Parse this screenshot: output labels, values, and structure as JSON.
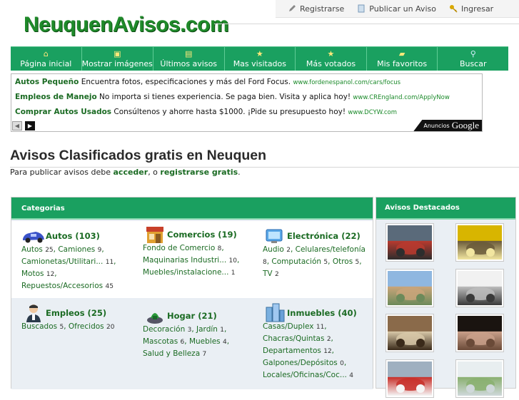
{
  "site": {
    "logo": "NeuquenAvisos.com"
  },
  "toplinks": [
    {
      "label": "Registrarse",
      "icon": "pencil-icon"
    },
    {
      "label": "Publicar un Aviso",
      "icon": "document-icon"
    },
    {
      "label": "Ingresar",
      "icon": "key-icon"
    }
  ],
  "nav": [
    {
      "label": "Página inicial",
      "icon": "home-icon"
    },
    {
      "label": "Mostrar imágenes",
      "icon": "images-icon"
    },
    {
      "label": "Últimos avisos",
      "icon": "latest-icon"
    },
    {
      "label": "Mas visitados",
      "icon": "star-icon"
    },
    {
      "label": "Más votados",
      "icon": "star-icon"
    },
    {
      "label": "Mis favoritos",
      "icon": "favorites-icon"
    },
    {
      "label": "Buscar",
      "icon": "search-icon"
    }
  ],
  "ads": [
    {
      "title": "Autos Pequeño",
      "text": " Encuentra fotos, especificaciones y más del Ford Focus.",
      "url": "www.fordenespanol.com/cars/focus"
    },
    {
      "title": "Empleos de Manejo",
      "text": " No importa si tienes experiencia. Se paga bien. Visita y aplica hoy!",
      "url": "www.CREngland.com/ApplyNow"
    },
    {
      "title": "Comprar Autos Usados",
      "text": " Consúltenos y ahorre hasta $1000. ¡Pide su presupuesto hoy!",
      "url": "www.DCYW.com"
    }
  ],
  "ad_badge": {
    "prefix": "Anuncios",
    "brand": "Google"
  },
  "heading": "Avisos Clasificados gratis en Neuquen",
  "subtitle": {
    "before": "Para publicar avisos debe ",
    "link1": "acceder",
    "mid": ", o ",
    "link2": "registrarse gratis",
    "after": "."
  },
  "categories_title": "Categorias",
  "categories": [
    {
      "name": "Autos",
      "count": "(103)",
      "icon": "car-icon",
      "subs": [
        [
          "Autos",
          "25"
        ],
        [
          "Camiones",
          "9"
        ],
        [
          "Camionetas/Utilitari...",
          "11"
        ],
        [
          "Motos",
          "12"
        ],
        [
          "Repuestos/Accesorios",
          "45"
        ]
      ]
    },
    {
      "name": "Comercios",
      "count": "(19)",
      "icon": "store-icon",
      "subs": [
        [
          "Fondo de Comercio",
          "8"
        ],
        [
          "Maquinarias Industri...",
          "10"
        ],
        [
          "Muebles/instalacione...",
          "1"
        ]
      ]
    },
    {
      "name": "Electrónica",
      "count": "(22)",
      "icon": "electronics-icon",
      "subs": [
        [
          "Audio",
          "2"
        ],
        [
          "Celulares/telefonía",
          "8"
        ],
        [
          "Computación",
          "5"
        ],
        [
          "Otros",
          "5"
        ],
        [
          "TV",
          "2"
        ]
      ]
    },
    {
      "name": "Empleos",
      "count": "(25)",
      "icon": "worker-icon",
      "subs": [
        [
          "Buscados",
          "5"
        ],
        [
          "Ofrecidos",
          "20"
        ]
      ]
    },
    {
      "name": "Hogar",
      "count": "(21)",
      "icon": "home-plant-icon",
      "subs": [
        [
          "Decoración",
          "3"
        ],
        [
          "Jardín",
          "1"
        ],
        [
          "Mascotas",
          "6"
        ],
        [
          "Muebles",
          "4"
        ],
        [
          "Salud y Belleza",
          "7"
        ]
      ]
    },
    {
      "name": "Inmuebles",
      "count": "(40)",
      "icon": "buildings-icon",
      "subs": [
        [
          "Casas/Duplex",
          "11"
        ],
        [
          "Chacras/Quintas",
          "2"
        ],
        [
          "Departamentos",
          "12"
        ],
        [
          "Galpones/Depósitos",
          "0"
        ],
        [
          "Locales/Oficinas/Coc...",
          "4"
        ]
      ]
    }
  ],
  "featured_title": "Avisos Destacados",
  "featured": [
    {
      "kind": "motorcycle",
      "colors": [
        "#5a6a7a",
        "#b83a2e",
        "#2d2d2d"
      ]
    },
    {
      "kind": "room",
      "colors": [
        "#d8b500",
        "#6a5a3a",
        "#f2e6a0"
      ]
    },
    {
      "kind": "field",
      "colors": [
        "#8fb7e0",
        "#c9a57a",
        "#6c8a5a"
      ]
    },
    {
      "kind": "car",
      "colors": [
        "#f1f1f1",
        "#bcbcbc",
        "#3a3a3a"
      ]
    },
    {
      "kind": "crowd",
      "colors": [
        "#8a6a4a",
        "#d8c8a8",
        "#3a2a1a"
      ]
    },
    {
      "kind": "belly",
      "colors": [
        "#1a1410",
        "#c9a08a",
        "#6a4a38"
      ]
    },
    {
      "kind": "dirtbike",
      "colors": [
        "#9fb0c0",
        "#c8302a",
        "#f5f5f5"
      ]
    },
    {
      "kind": "landscape",
      "colors": [
        "#e8eef0",
        "#8ab070",
        "#cfd8da"
      ]
    }
  ]
}
